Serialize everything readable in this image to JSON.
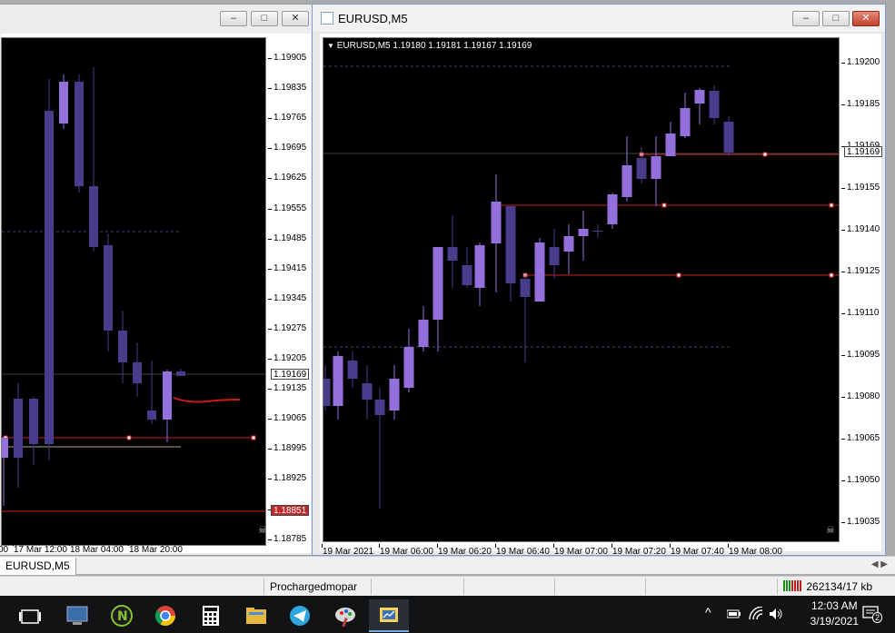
{
  "left_window": {
    "price_labels": [
      "1.19905",
      "1.19835",
      "1.19765",
      "1.19695",
      "1.19625",
      "1.19555",
      "1.19485",
      "1.19415",
      "1.19345",
      "1.19275",
      "1.19205",
      "1.19135",
      "1.19065",
      "1.18995",
      "1.18925",
      "1.18855",
      "1.18785"
    ],
    "current_price": "1.19169",
    "level_price": "1.18851",
    "time_labels": [
      "00",
      "17 Mar 12:00",
      "18 Mar 04:00",
      "18 Mar 20:00"
    ],
    "colors": {
      "bull": "#9370DB",
      "bear": "#483D8B",
      "level": "#cc2020",
      "badge_red": "#c0282a"
    }
  },
  "right_window": {
    "title": "EURUSD,M5",
    "chart_header": "EURUSD,M5  1.19180 1.19181 1.19167 1.19169",
    "price_labels": [
      "1.19200",
      "1.19185",
      "1.19169",
      "1.19155",
      "1.19140",
      "1.19125",
      "1.19110",
      "1.19095",
      "1.19080",
      "1.19065",
      "1.19050",
      "1.19035"
    ],
    "current_price": "1.19169",
    "time_labels": [
      "19 Mar 2021",
      "19 Mar 06:00",
      "19 Mar 06:20",
      "19 Mar 06:40",
      "19 Mar 07:00",
      "19 Mar 07:20",
      "19 Mar 07:40",
      "19 Mar 08:00"
    ],
    "buttons": {
      "minimize": "–",
      "maximize": "□",
      "close": "✕"
    }
  },
  "tabs": {
    "active": "EURUSD,M5"
  },
  "status": {
    "profile": "Prochargedmopar",
    "traffic": "262134/17 kb"
  },
  "clock": {
    "time": "12:03 AM",
    "date": "3/19/2021"
  },
  "notifications": "2",
  "icons": [
    "task-view-icon",
    "computer-icon",
    "n-app-icon",
    "chrome-icon",
    "calculator-icon",
    "file-explorer-icon",
    "telegram-icon",
    "paint-icon",
    "metatrader-icon"
  ]
}
